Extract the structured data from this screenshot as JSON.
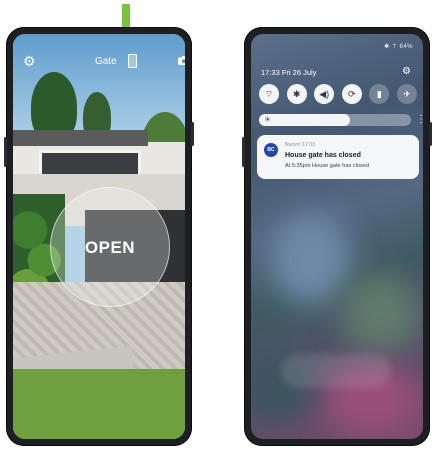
{
  "phone1": {
    "gate_label": "Gate",
    "open_label": "OPEN",
    "icons": {
      "settings": "gear-icon",
      "gate": "gate-icon",
      "camera": "camera-icon",
      "arrow": "arrow-down-icon"
    },
    "arrow_color": "#7bc043"
  },
  "phone2": {
    "status_text": "✱ ⇡ 64%",
    "time_date": "17:33  Fri 26 July",
    "quick_settings": [
      {
        "name": "wifi",
        "icon": "wifi-icon",
        "glyph": "⌔",
        "active": true
      },
      {
        "name": "bluetooth",
        "icon": "bluetooth-icon",
        "glyph": "✱",
        "active": true
      },
      {
        "name": "sound",
        "icon": "sound-icon",
        "glyph": "◀)",
        "active": true
      },
      {
        "name": "auto-rotate",
        "icon": "rotate-icon",
        "glyph": "⟳",
        "active": true
      },
      {
        "name": "flashlight",
        "icon": "flashlight-icon",
        "glyph": "▮",
        "active": false
      },
      {
        "name": "airplane",
        "icon": "airplane-icon",
        "glyph": "✈",
        "active": false
      }
    ],
    "brightness_level": 0.6,
    "notification": {
      "avatar": "BC",
      "app": "Nuovo!  17:33",
      "title": "House gate has closed",
      "body": "At 5:35pm House gate has closed"
    }
  }
}
